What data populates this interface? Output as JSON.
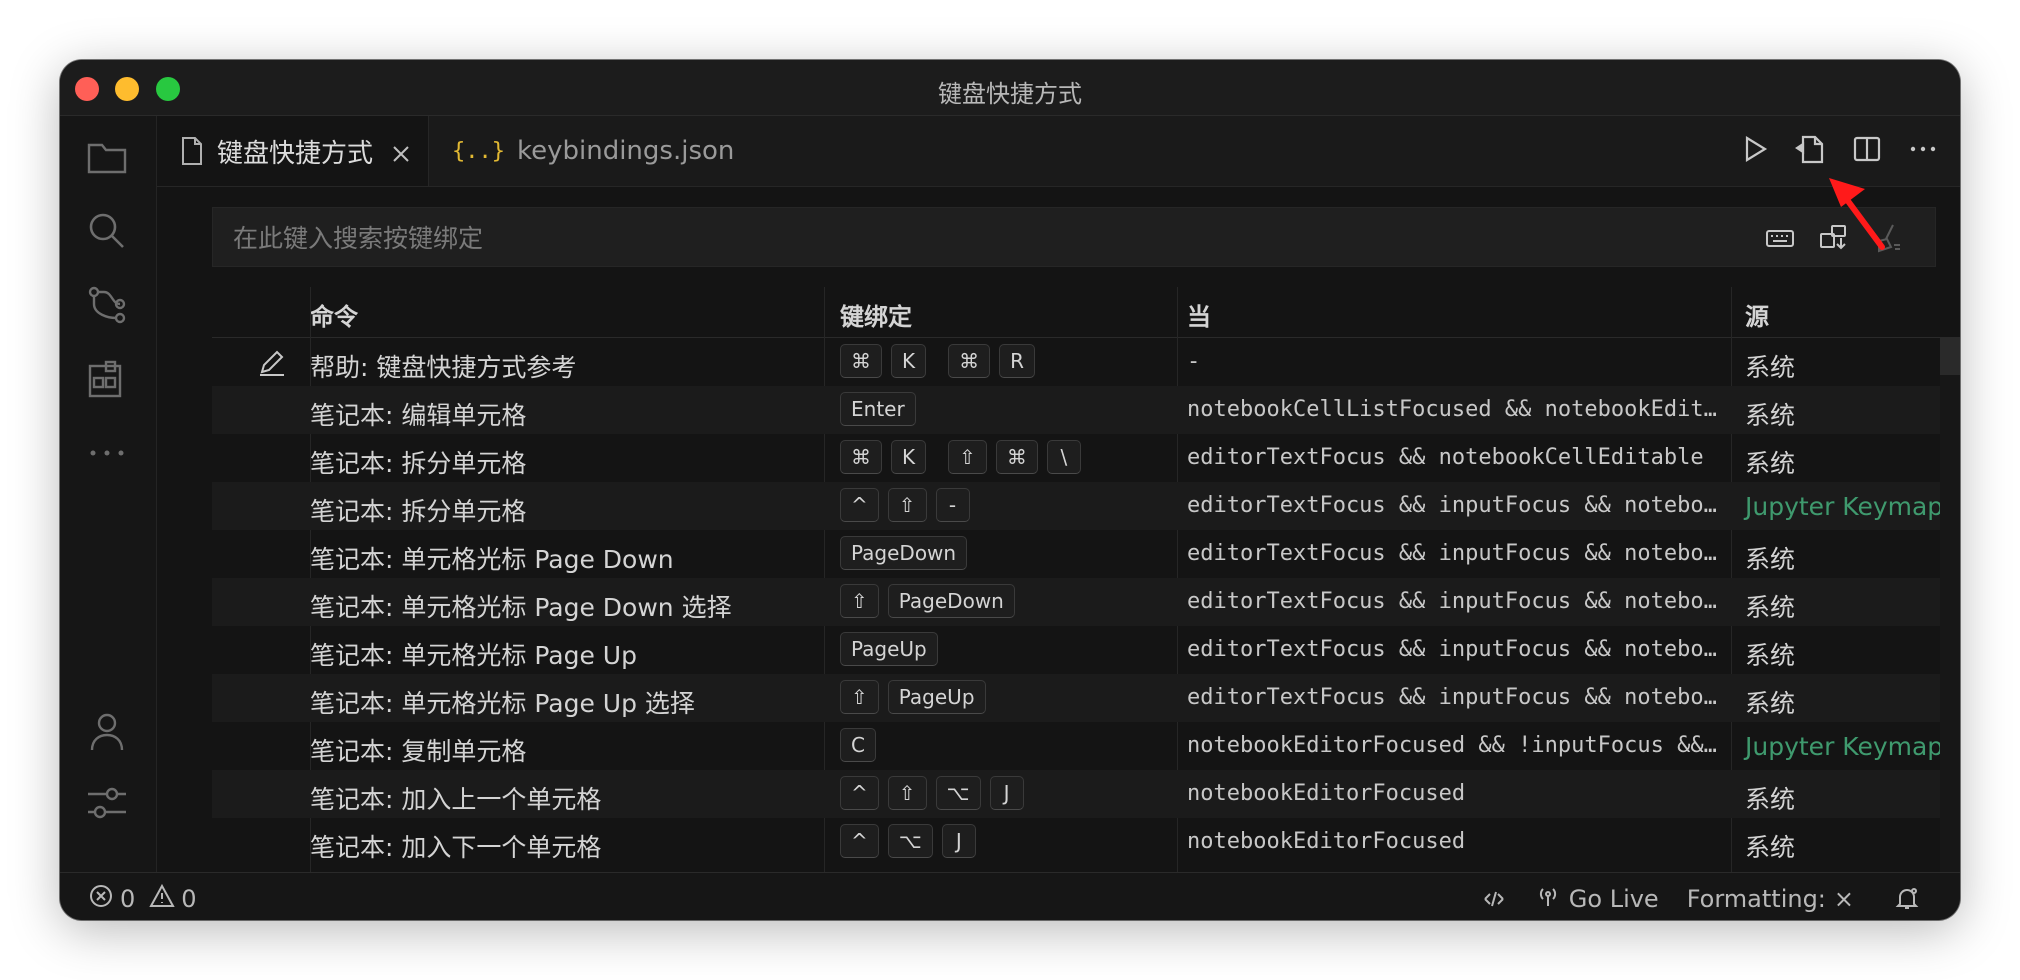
{
  "window": {
    "title": "键盘快捷方式"
  },
  "tabs": [
    {
      "label": "键盘快捷方式",
      "active": true,
      "icon": "file-icon"
    },
    {
      "label": "keybindings.json",
      "active": false,
      "icon": "json-icon"
    }
  ],
  "search": {
    "placeholder": "在此键入搜索按键绑定",
    "value": ""
  },
  "table": {
    "headers": {
      "command": "命令",
      "keybinding": "键绑定",
      "when": "当",
      "source": "源"
    },
    "rows": [
      {
        "command": "帮助: 键盘快捷方式参考",
        "keys": [
          [
            "⌘",
            "K"
          ],
          [
            "⌘",
            "R"
          ]
        ],
        "when": "-",
        "source": "系统",
        "ext": false,
        "edit": true
      },
      {
        "command": "笔记本: 编辑单元格",
        "keys": [
          [
            "Enter"
          ]
        ],
        "when": "notebookCellListFocused && notebookEditorFocused",
        "source": "系统",
        "ext": false
      },
      {
        "command": "笔记本: 拆分单元格",
        "keys": [
          [
            "⌘",
            "K"
          ],
          [
            "⇧",
            "⌘",
            "\\"
          ]
        ],
        "when": "editorTextFocus && notebookCellEditable",
        "source": "系统",
        "ext": false
      },
      {
        "command": "笔记本: 拆分单元格",
        "keys": [
          [
            "^",
            "⇧",
            "-"
          ]
        ],
        "when": "editorTextFocus && inputFocus && notebookEditorFocused",
        "source": "Jupyter Keymap",
        "ext": true
      },
      {
        "command": "笔记本: 单元格光标 Page Down",
        "keys": [
          [
            "PageDown"
          ]
        ],
        "when": "editorTextFocus && inputFocus && notebookEditorFocused",
        "source": "系统",
        "ext": false
      },
      {
        "command": "笔记本: 单元格光标 Page Down 选择",
        "keys": [
          [
            "⇧",
            "PageDown"
          ]
        ],
        "when": "editorTextFocus && inputFocus && notebookEditorFocused",
        "source": "系统",
        "ext": false
      },
      {
        "command": "笔记本: 单元格光标 Page Up",
        "keys": [
          [
            "PageUp"
          ]
        ],
        "when": "editorTextFocus && inputFocus && notebookEditorFocused",
        "source": "系统",
        "ext": false
      },
      {
        "command": "笔记本: 单元格光标 Page Up 选择",
        "keys": [
          [
            "⇧",
            "PageUp"
          ]
        ],
        "when": "editorTextFocus && inputFocus && notebookEditorFocused",
        "source": "系统",
        "ext": false
      },
      {
        "command": "笔记本: 复制单元格",
        "keys": [
          [
            "C"
          ]
        ],
        "when": "notebookEditorFocused && !inputFocus && notebookCellListFocused",
        "source": "Jupyter Keymap",
        "ext": true
      },
      {
        "command": "笔记本: 加入上一个单元格",
        "keys": [
          [
            "^",
            "⇧",
            "⌥",
            "J"
          ]
        ],
        "when": "notebookEditorFocused",
        "source": "系统",
        "ext": false
      },
      {
        "command": "笔记本: 加入下一个单元格",
        "keys": [
          [
            "^",
            "⌥",
            "J"
          ]
        ],
        "when": "notebookEditorFocused",
        "source": "系统",
        "ext": false
      }
    ]
  },
  "status": {
    "errors": "0",
    "warnings": "0",
    "go_live": "Go Live",
    "formatting": "Formatting:",
    "formatting_state": "×"
  },
  "colors": {
    "background": "#141414",
    "extension_source": "#3f9a6e",
    "annotation_arrow": "#ff1a1a"
  }
}
